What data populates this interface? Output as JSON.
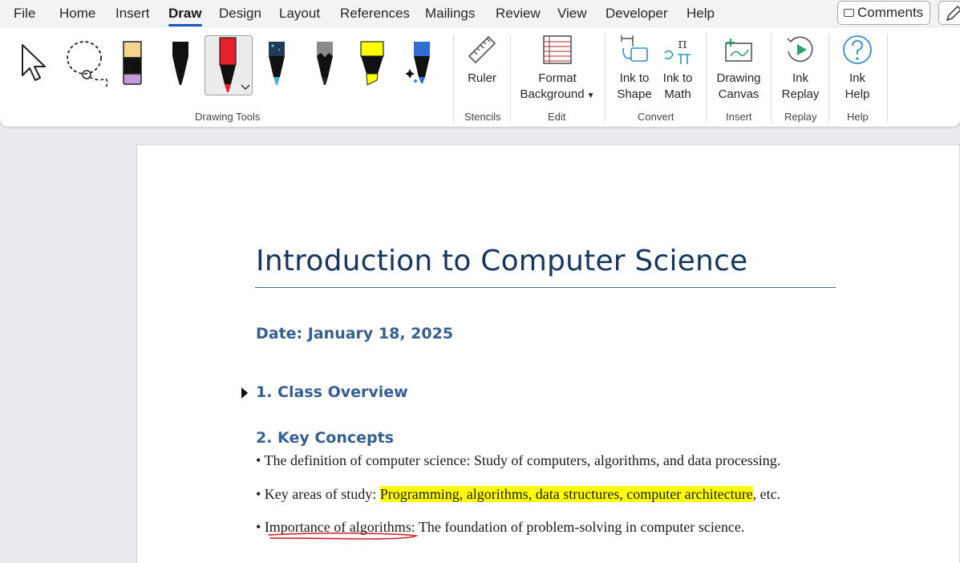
{
  "menu": {
    "items": [
      "File",
      "Home",
      "Insert",
      "Draw",
      "Design",
      "Layout",
      "References",
      "Mailings",
      "Review",
      "View",
      "Developer",
      "Help"
    ],
    "active": "Draw",
    "comments_label": "Comments"
  },
  "ribbon": {
    "groups": {
      "drawing_tools": "Drawing Tools",
      "stencils": "Stencils",
      "edit": "Edit",
      "convert": "Convert",
      "insert": "Insert",
      "replay": "Replay",
      "help": "Help"
    },
    "buttons": {
      "ruler": "Ruler",
      "format_background_1": "Format",
      "format_background_2": "Background",
      "ink_to_shape_1": "Ink to",
      "ink_to_shape_2": "Shape",
      "ink_to_math_1": "Ink to",
      "ink_to_math_2": "Math",
      "drawing_canvas_1": "Drawing",
      "drawing_canvas_2": "Canvas",
      "ink_replay_1": "Ink",
      "ink_replay_2": "Replay",
      "ink_help_1": "Ink",
      "ink_help_2": "Help"
    },
    "tools": [
      "select-arrow-icon",
      "lasso-icon",
      "eraser-icon",
      "black-pen-icon",
      "red-pen-icon",
      "galaxy-pen-icon",
      "pencil-icon",
      "yellow-highlighter-icon",
      "action-pen-icon"
    ],
    "colors": {
      "accent": "#185abd",
      "red_pen": "#e8202a",
      "highlighter": "#ffff00"
    }
  },
  "document": {
    "title": "Introduction to Computer Science",
    "date": "Date: January 18, 2025",
    "section1": "1. Class Overview",
    "section2": "2. Key Concepts",
    "bullet1": "• The definition of computer science: Study of computers, algorithms, and data processing.",
    "bullet2_pre": "• Key areas of study: ",
    "bullet2_highlight": "Programming, algorithms, data structures, computer architecture",
    "bullet2_post": ", etc.",
    "bullet3_pre": "• ",
    "bullet3_underlined": "Importance of algorithms",
    "bullet3_post": ": The foundation of problem-solving in computer science."
  }
}
